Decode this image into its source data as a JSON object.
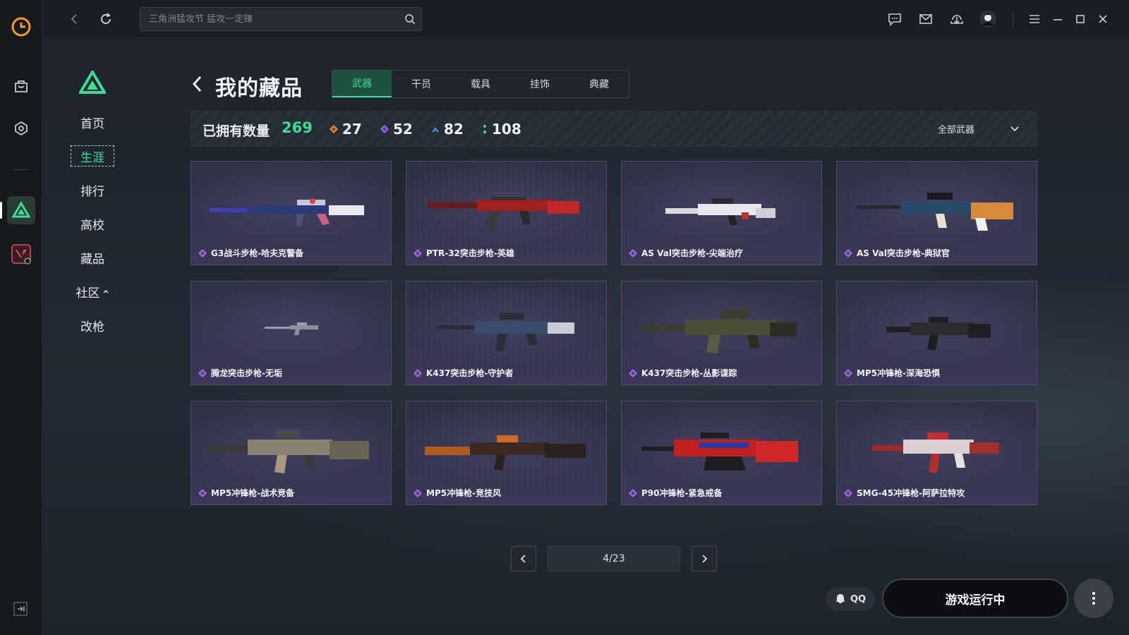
{
  "search": {
    "placeholder": "三角洲猛攻节 猛攻一定赚"
  },
  "subnav": {
    "items": [
      {
        "label": "首页"
      },
      {
        "label": "生涯"
      },
      {
        "label": "排行"
      },
      {
        "label": "高校"
      },
      {
        "label": "藏品"
      },
      {
        "label": "社区"
      },
      {
        "label": "改枪"
      }
    ]
  },
  "page": {
    "title": "我的藏品"
  },
  "tabs": [
    {
      "label": "武器"
    },
    {
      "label": "干员"
    },
    {
      "label": "载具"
    },
    {
      "label": "挂饰"
    },
    {
      "label": "典藏"
    }
  ],
  "stats": {
    "owned_label": "已拥有数量",
    "owned_value": "269",
    "rarity": [
      {
        "value": "27",
        "color": "#e08a3c"
      },
      {
        "value": "52",
        "color": "#9a6bd8"
      },
      {
        "value": "82",
        "color": "#4a8fe0"
      },
      {
        "value": "108",
        "color": "#3ddc97"
      }
    ],
    "filter_label": "全部武器"
  },
  "cards": [
    {
      "name": "G3战斗步枪-哈夫克警备"
    },
    {
      "name": "PTR-32突击步枪-英雄"
    },
    {
      "name": "AS Val突击步枪-尖端治疗"
    },
    {
      "name": "AS Val突击步枪-典狱官"
    },
    {
      "name": "腾龙突击步枪-无垢"
    },
    {
      "name": "K437突击步枪-守护者"
    },
    {
      "name": "K437突击步枪-丛影谍踪"
    },
    {
      "name": "MP5冲锋枪-深海恐惧"
    },
    {
      "name": "MP5冲锋枪-战术竞备"
    },
    {
      "name": "MP5冲锋枪-竞技风"
    },
    {
      "name": "P90冲锋枪-紧急戒备"
    },
    {
      "name": "SMG-45冲锋枪-阿萨拉特攻"
    }
  ],
  "pagination": {
    "display": "4/23"
  },
  "footer": {
    "qq_label": "QQ",
    "launch_label": "游戏运行中"
  },
  "colors": {
    "accent": "#3ddc97",
    "rarity_purple": "#9a6bd8"
  }
}
